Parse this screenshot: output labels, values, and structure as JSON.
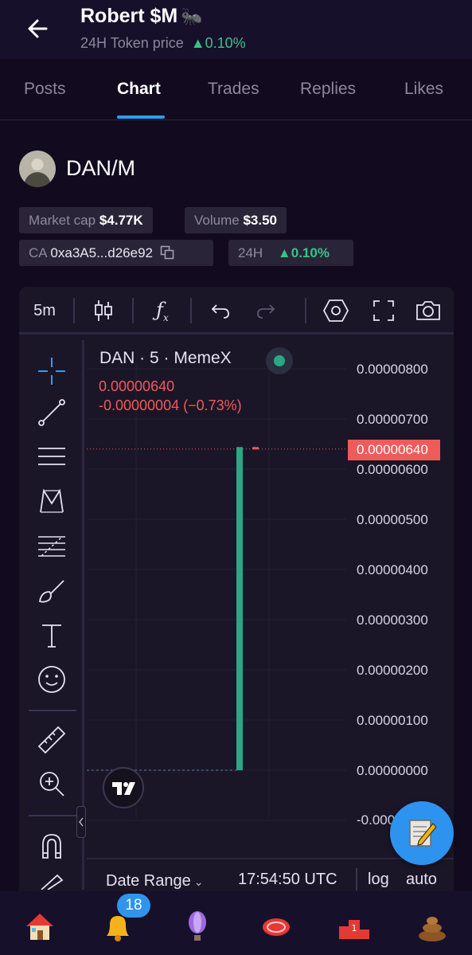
{
  "header": {
    "title": "Robert $M",
    "title_emoji": "🐜",
    "subtitle_label": "24H Token price",
    "subtitle_change": "▲0.10%"
  },
  "tabs": [
    "Posts",
    "Chart",
    "Trades",
    "Replies",
    "Likes"
  ],
  "active_tab": "Chart",
  "token": {
    "pair": "DAN/M",
    "market_cap_label": "Market cap",
    "market_cap_value": "$4.77K",
    "volume_label": "Volume",
    "volume_value": "$3.50",
    "ca_label": "CA",
    "ca_value": "0xa3A5...d26e92",
    "period_label": "24H",
    "period_change": "▲0.10%"
  },
  "chart_toolbar": {
    "interval": "5m",
    "icons": [
      "candles-icon",
      "indicators-icon",
      "undo-icon",
      "redo-icon",
      "settings-icon",
      "fullscreen-icon",
      "camera-icon"
    ]
  },
  "left_tools": [
    "crosshair-icon",
    "trend-line-icon",
    "horizontal-lines-icon",
    "pattern-icon",
    "fib-icon",
    "brush-icon",
    "text-icon",
    "emoji-icon",
    "ruler-icon",
    "zoom-in-icon",
    "magnet-icon",
    "pencil-icon"
  ],
  "chart_data": {
    "type": "bar",
    "title": "DAN · 5 · MemeX",
    "last_price": "0.00000640",
    "change": "-0.00000004 (−0.73%)",
    "price_tag": "0.00000640",
    "y_ticks": [
      "0.00000800",
      "0.00000700",
      "0.00000600",
      "0.00000500",
      "0.00000400",
      "0.00000300",
      "0.00000200",
      "0.00000100",
      "0.00000000",
      "-0.000"
    ],
    "ylim": [
      -1e-07,
      8e-07
    ],
    "candles": [
      {
        "open": 0.0,
        "close": 6.44e-06,
        "color": "#2aa784"
      },
      {
        "open": 6.44e-06,
        "close": 6.4e-06,
        "color": "#ef5b5b"
      }
    ],
    "grid": true
  },
  "bottom_bar": {
    "date_range": "Date Range",
    "time": "17:54:50 UTC",
    "log": "log",
    "auto": "auto"
  },
  "nav": {
    "items": [
      "home-icon",
      "bell-icon",
      "balloon-icon",
      "meat-icon",
      "podium-icon",
      "poop-icon"
    ],
    "notification_count": "18"
  },
  "colors": {
    "background": "#120b1f",
    "accent": "#2e9df0",
    "up": "#35c38b",
    "down": "#ef5b5b"
  }
}
